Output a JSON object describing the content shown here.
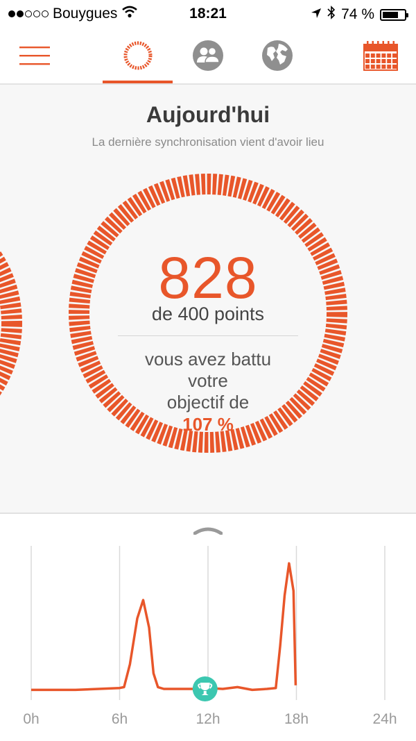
{
  "status_bar": {
    "carrier": "Bouygues",
    "time": "18:21",
    "battery_text": "74 %",
    "battery_level": 0.74,
    "signal_bars_filled": 2,
    "signal_bars_total": 5
  },
  "nav": {
    "menu_icon": "hamburger-menu-icon",
    "tabs": [
      {
        "icon": "activity-ring-icon",
        "active": true
      },
      {
        "icon": "friends-icon",
        "active": false
      },
      {
        "icon": "globe-icon",
        "active": false
      }
    ],
    "calendar_icon": "calendar-icon"
  },
  "summary": {
    "title": "Aujourd'hui",
    "subtitle": "La dernière synchronisation vient d'avoir lieu",
    "points": "828",
    "goal_text": "de 400 points",
    "beat_line1": "vous avez battu",
    "beat_line2": "votre",
    "beat_line3": "objectif de",
    "percent": "107 %",
    "ring_progress": 1.0
  },
  "colors": {
    "accent": "#e8562a",
    "trophy": "#3cc7b0",
    "grid": "#dadada",
    "text_muted": "#9a9a9a"
  },
  "chart_data": {
    "type": "line",
    "x_unit": "h",
    "xlim": [
      0,
      24
    ],
    "xticks": [
      "0h",
      "6h",
      "12h",
      "18h",
      "24h"
    ],
    "points": [
      [
        0,
        0.2
      ],
      [
        3,
        0.2
      ],
      [
        6,
        0.4
      ],
      [
        6.3,
        0.5
      ],
      [
        6.7,
        3.0
      ],
      [
        7.2,
        8.0
      ],
      [
        7.6,
        10.0
      ],
      [
        8.0,
        7.0
      ],
      [
        8.3,
        2.0
      ],
      [
        8.6,
        0.5
      ],
      [
        9,
        0.3
      ],
      [
        11,
        0.3
      ],
      [
        12,
        0.4
      ],
      [
        13,
        0.3
      ],
      [
        14,
        0.5
      ],
      [
        15,
        0.2
      ],
      [
        16,
        0.3
      ],
      [
        16.6,
        0.4
      ],
      [
        16.9,
        5.0
      ],
      [
        17.2,
        10.5
      ],
      [
        17.5,
        14.0
      ],
      [
        17.8,
        11.0
      ],
      [
        17.95,
        0.7
      ]
    ],
    "ylim": [
      0,
      15
    ],
    "marker": {
      "x": 11.8,
      "icon": "trophy-icon"
    }
  }
}
